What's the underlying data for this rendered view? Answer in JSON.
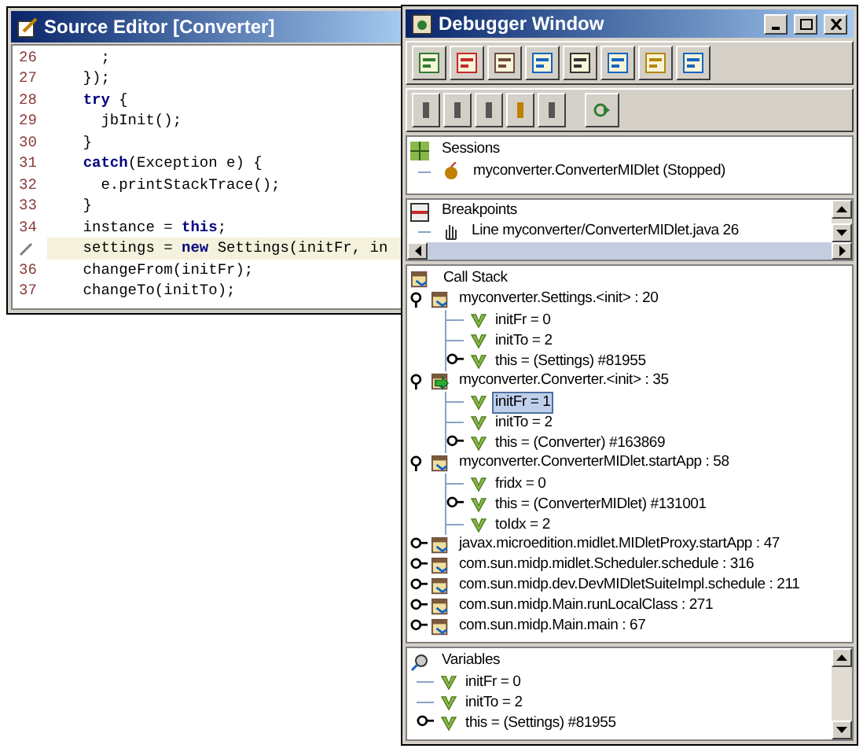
{
  "editor": {
    "title": "Source Editor [Converter]",
    "lines": [
      {
        "number": "26",
        "current": false,
        "marker": false,
        "text": "      ;"
      },
      {
        "number": "27",
        "current": false,
        "marker": false,
        "text": "    });"
      },
      {
        "number": "28",
        "current": false,
        "marker": false,
        "text": "    **try** {"
      },
      {
        "number": "29",
        "current": false,
        "marker": false,
        "text": "      jbInit();"
      },
      {
        "number": "30",
        "current": false,
        "marker": false,
        "text": "    }"
      },
      {
        "number": "31",
        "current": false,
        "marker": false,
        "text": "    **catch**(Exception e) {"
      },
      {
        "number": "32",
        "current": false,
        "marker": false,
        "text": "      e.printStackTrace();"
      },
      {
        "number": "33",
        "current": false,
        "marker": false,
        "text": "    }"
      },
      {
        "number": "34",
        "current": false,
        "marker": false,
        "text": "    instance = **this**;"
      },
      {
        "current": true,
        "marker": true,
        "text": "    settings = **new** Settings(initFr, in"
      },
      {
        "number": "36",
        "current": false,
        "marker": false,
        "text": "    changeFrom(initFr);"
      },
      {
        "number": "37",
        "current": false,
        "marker": false,
        "text": "    changeTo(initTo);"
      }
    ]
  },
  "debugger": {
    "title": "Debugger Window",
    "sessions": {
      "title": "Sessions",
      "items": [
        "myconverter.ConverterMIDlet (Stopped)"
      ]
    },
    "breakpoints": {
      "title": "Breakpoints",
      "items": [
        "Line myconverter/ConverterMIDlet.java 26"
      ]
    },
    "call_stack": {
      "title": "Call Stack",
      "children": [
        {
          "kind": "frame",
          "label": "myconverter.Settings.<init> : 20",
          "expanded": true,
          "current": false,
          "children": [
            {
              "kind": "variable",
              "label": "initFr = 0",
              "expandable": false,
              "selected": false
            },
            {
              "kind": "variable",
              "label": "initTo = 2",
              "expandable": false,
              "selected": false
            },
            {
              "kind": "variable",
              "label": "this = (Settings) #81955",
              "expandable": true,
              "selected": false
            }
          ]
        },
        {
          "kind": "frame",
          "label": "myconverter.Converter.<init> : 35",
          "expanded": true,
          "current": true,
          "children": [
            {
              "kind": "variable",
              "label": "initFr = 1",
              "expandable": false,
              "selected": true
            },
            {
              "kind": "variable",
              "label": "initTo = 2",
              "expandable": false,
              "selected": false
            },
            {
              "kind": "variable",
              "label": "this = (Converter) #163869",
              "expandable": true,
              "selected": false
            }
          ]
        },
        {
          "kind": "frame",
          "label": "myconverter.ConverterMIDlet.startApp : 58",
          "expanded": true,
          "current": false,
          "children": [
            {
              "kind": "variable",
              "label": "fridx = 0",
              "expandable": false,
              "selected": false
            },
            {
              "kind": "variable",
              "label": "this = (ConverterMIDlet) #131001",
              "expandable": true,
              "selected": false
            },
            {
              "kind": "variable",
              "label": "toIdx = 2",
              "expandable": false,
              "selected": false
            }
          ]
        },
        {
          "kind": "frame",
          "label": "javax.microedition.midlet.MIDletProxy.startApp : 47",
          "expanded": false,
          "current": false
        },
        {
          "kind": "frame",
          "label": "com.sun.midp.midlet.Scheduler.schedule : 316",
          "expanded": false,
          "current": false
        },
        {
          "kind": "frame",
          "label": "com.sun.midp.dev.DevMIDletSuiteImpl.schedule : 211",
          "expanded": false,
          "current": false
        },
        {
          "kind": "frame",
          "label": "com.sun.midp.Main.runLocalClass : 271",
          "expanded": false,
          "current": false
        },
        {
          "kind": "frame",
          "label": "com.sun.midp.Main.main : 67",
          "expanded": false,
          "current": false
        }
      ]
    },
    "variables": {
      "title": "Variables",
      "children": [
        {
          "kind": "variable",
          "label": "initFr = 0",
          "expandable": false,
          "selected": false
        },
        {
          "kind": "variable",
          "label": "initTo = 2",
          "expandable": false,
          "selected": false
        },
        {
          "kind": "variable",
          "label": "this = (Settings) #81955",
          "expandable": true,
          "selected": false
        }
      ]
    }
  }
}
